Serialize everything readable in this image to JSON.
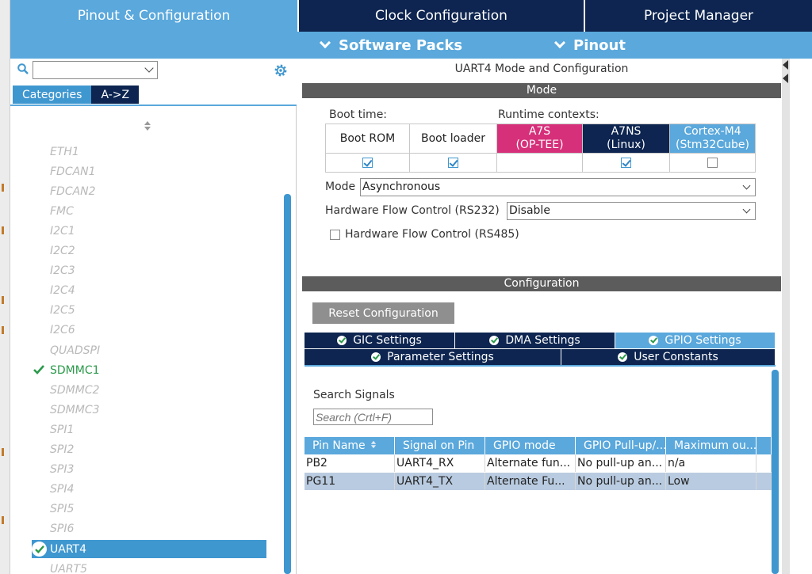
{
  "top_tabs": [
    "Pinout & Configuration",
    "Clock Configuration",
    "Project Manager"
  ],
  "sub_menu": [
    "Software Packs",
    "Pinout"
  ],
  "left": {
    "search_value": "",
    "category_tabs": [
      "Categories",
      "A->Z"
    ],
    "items": [
      {
        "label": "ETH1",
        "state": "disabled"
      },
      {
        "label": "FDCAN1",
        "state": "disabled"
      },
      {
        "label": "FDCAN2",
        "state": "disabled"
      },
      {
        "label": "FMC",
        "state": "disabled"
      },
      {
        "label": "I2C1",
        "state": "disabled"
      },
      {
        "label": "I2C2",
        "state": "disabled"
      },
      {
        "label": "I2C3",
        "state": "disabled"
      },
      {
        "label": "I2C4",
        "state": "disabled"
      },
      {
        "label": "I2C5",
        "state": "disabled"
      },
      {
        "label": "I2C6",
        "state": "disabled"
      },
      {
        "label": "QUADSPI",
        "state": "disabled"
      },
      {
        "label": "SDMMC1",
        "state": "enabled"
      },
      {
        "label": "SDMMC2",
        "state": "disabled"
      },
      {
        "label": "SDMMC3",
        "state": "disabled"
      },
      {
        "label": "SPI1",
        "state": "disabled"
      },
      {
        "label": "SPI2",
        "state": "disabled"
      },
      {
        "label": "SPI3",
        "state": "disabled"
      },
      {
        "label": "SPI4",
        "state": "disabled"
      },
      {
        "label": "SPI5",
        "state": "disabled"
      },
      {
        "label": "SPI6",
        "state": "disabled"
      },
      {
        "label": "UART4",
        "state": "selected"
      },
      {
        "label": "UART5",
        "state": "disabled"
      }
    ]
  },
  "right": {
    "title": "UART4 Mode and Configuration",
    "mode_section": "Mode",
    "boot_time_label": "Boot time:",
    "runtime_label": "Runtime contexts:",
    "contexts": [
      {
        "line1": "Boot ROM",
        "line2": "",
        "checked": true,
        "color": "#ffffff",
        "fg": "#222222"
      },
      {
        "line1": "Boot loader",
        "line2": "",
        "checked": true,
        "color": "#ffffff",
        "fg": "#222222"
      },
      {
        "line1": "A7S",
        "line2": "(OP-TEE)",
        "checked": null,
        "color": "#d6307a",
        "fg": "#ffffff"
      },
      {
        "line1": "A7NS",
        "line2": "(Linux)",
        "checked": true,
        "color": "#0d2550",
        "fg": "#ffffff"
      },
      {
        "line1": "Cortex-M4",
        "line2": "(Stm32Cube)",
        "checked": false,
        "color": "#5aa8dc",
        "fg": "#ffffff"
      }
    ],
    "mode_label": "Mode",
    "mode_value": "Asynchronous",
    "hfc232_label": "Hardware Flow Control (RS232)",
    "hfc232_value": "Disable",
    "hfc485_label": "Hardware Flow Control (RS485)",
    "config_section": "Configuration",
    "reset_label": "Reset Configuration",
    "config_tabs_row1": [
      "GIC Settings",
      "DMA Settings",
      "GPIO Settings"
    ],
    "config_tabs_row2": [
      "Parameter Settings",
      "User Constants"
    ],
    "active_tab": "GPIO Settings",
    "search_signals_label": "Search Signals",
    "search_placeholder": "Search (Crtl+F)",
    "table_headers": [
      "Pin Name",
      "Signal on Pin",
      "GPIO mode",
      "GPIO Pull-up/...",
      "Maximum ou..."
    ],
    "table_rows": [
      [
        "PB2",
        "UART4_RX",
        "Alternate fun...",
        "No pull-up an...",
        "n/a"
      ],
      [
        "PG11",
        "UART4_TX",
        "Alternate Fu...",
        "No pull-up an...",
        "Low"
      ]
    ]
  }
}
